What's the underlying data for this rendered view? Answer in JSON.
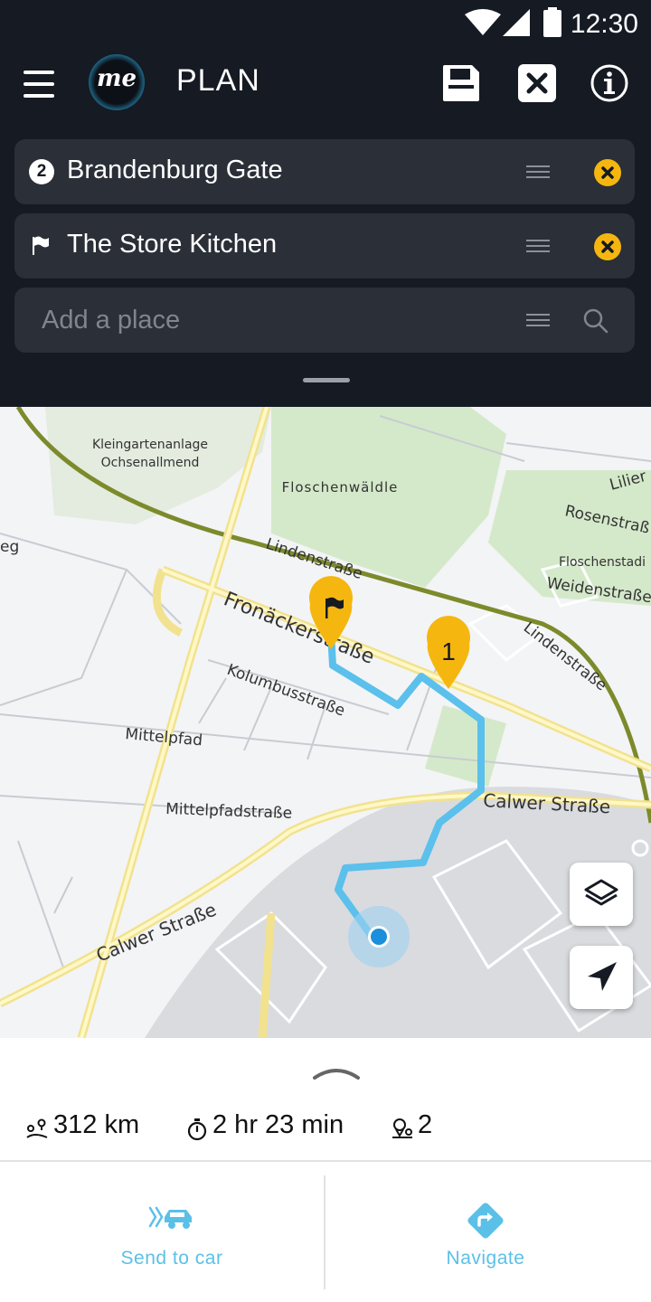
{
  "status_bar": {
    "time": "12:30"
  },
  "header": {
    "title": "PLAN",
    "logo_text": "me"
  },
  "waypoints": [
    {
      "badge": "2",
      "label": "Brandenburg Gate"
    },
    {
      "label": "The Store Kitchen"
    }
  ],
  "add_place": {
    "placeholder": "Add a place"
  },
  "map": {
    "labels": {
      "kleingarten_1": "Kleingartenanlage",
      "kleingarten_2": "Ochsenallmend",
      "floschenwaeldle": "Floschenwäldle",
      "lindenstrasse_1": "Lindenstraße",
      "lindenstrasse_2": "Lindenstraße",
      "fronaeckerstrasse": "Fronäckerstraße",
      "kolumbusstrasse": "Kolumbusstraße",
      "mittelpfad": "Mittelpfad",
      "mittelpfadstrasse": "Mittelpfadstraße",
      "calwer_strasse_1": "Calwer Straße",
      "calwer_strasse_2": "Calwer Straße",
      "rosenstrasse": "Rosenstraß",
      "weidenstrasse": "Weidenstraße",
      "floschenstadion": "Floschenstadi",
      "lilien": "Lilier",
      "edge_eg": "eg"
    },
    "pin_number": "1",
    "colors": {
      "route": "#5bc0eb",
      "pin": "#f5b70f",
      "location": "#1a8fdc"
    }
  },
  "summary": {
    "distance": "312 km",
    "duration": "2 hr 23 min",
    "stops": "2"
  },
  "actions": {
    "send_to_car": "Send to car",
    "navigate": "Navigate"
  }
}
